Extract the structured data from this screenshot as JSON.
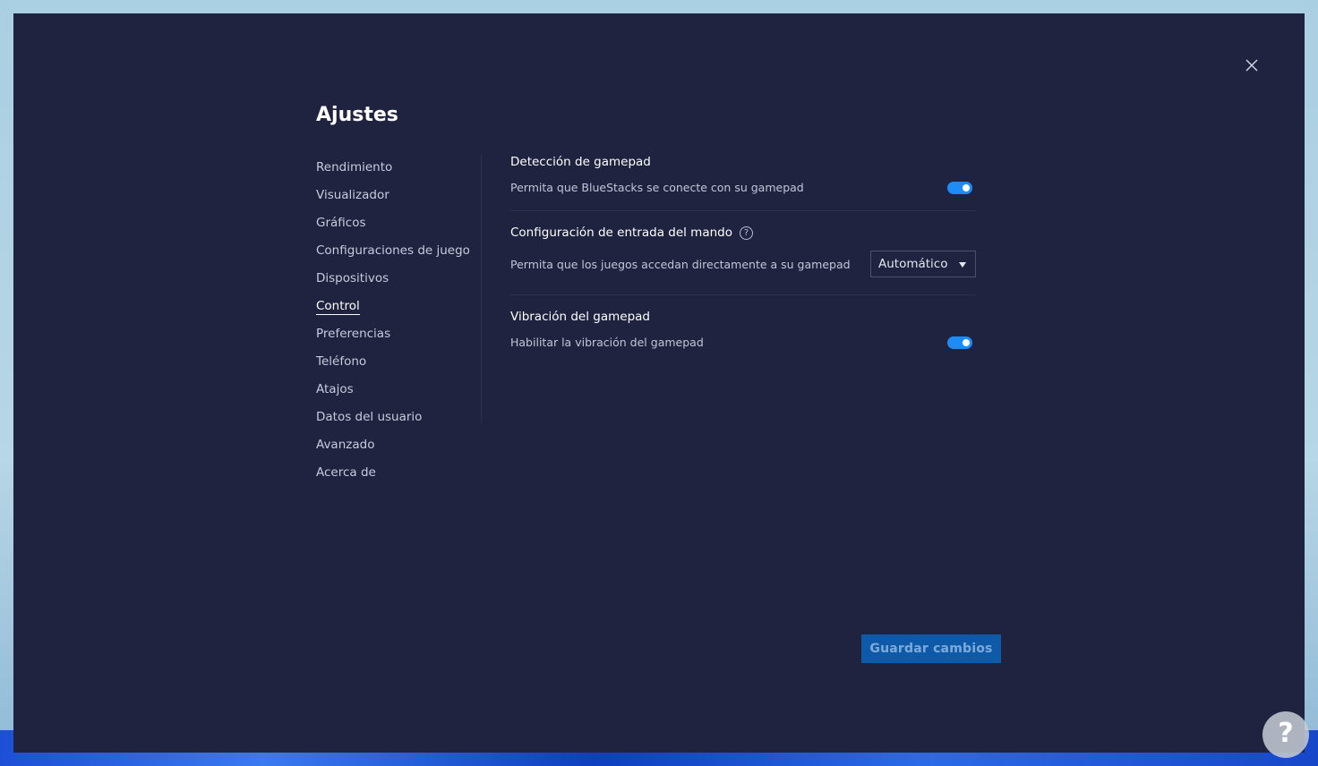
{
  "window": {
    "title": "Ajustes"
  },
  "sidebar": {
    "items": [
      {
        "label": "Rendimiento"
      },
      {
        "label": "Visualizador"
      },
      {
        "label": "Gráficos"
      },
      {
        "label": "Configuraciones de juego"
      },
      {
        "label": "Dispositivos"
      },
      {
        "label": "Control",
        "active": true
      },
      {
        "label": "Preferencias"
      },
      {
        "label": "Teléfono"
      },
      {
        "label": "Atajos"
      },
      {
        "label": "Datos del usuario"
      },
      {
        "label": "Avanzado"
      },
      {
        "label": "Acerca de"
      }
    ]
  },
  "sections": {
    "gamepad_detection": {
      "title": "Detección de gamepad",
      "description": "Permita que BlueStacks se conecte con su gamepad",
      "enabled": true
    },
    "input_config": {
      "title": "Configuración de entrada del mando",
      "help_icon": "?",
      "description": "Permita que los juegos accedan directamente a su gamepad",
      "selected_value": "Automático"
    },
    "vibration": {
      "title": "Vibración del gamepad",
      "description": "Habilitar la vibración del gamepad",
      "enabled": true
    }
  },
  "footer": {
    "save_label": "Guardar cambios"
  },
  "colors": {
    "background": "#1f2340",
    "accent": "#1d8cf8",
    "save_button": "#0e5aa8"
  },
  "icons": [
    "close-icon",
    "help-icon",
    "chevron-down-icon",
    "toggle-switch"
  ],
  "watermark": {
    "glyph": "?"
  }
}
